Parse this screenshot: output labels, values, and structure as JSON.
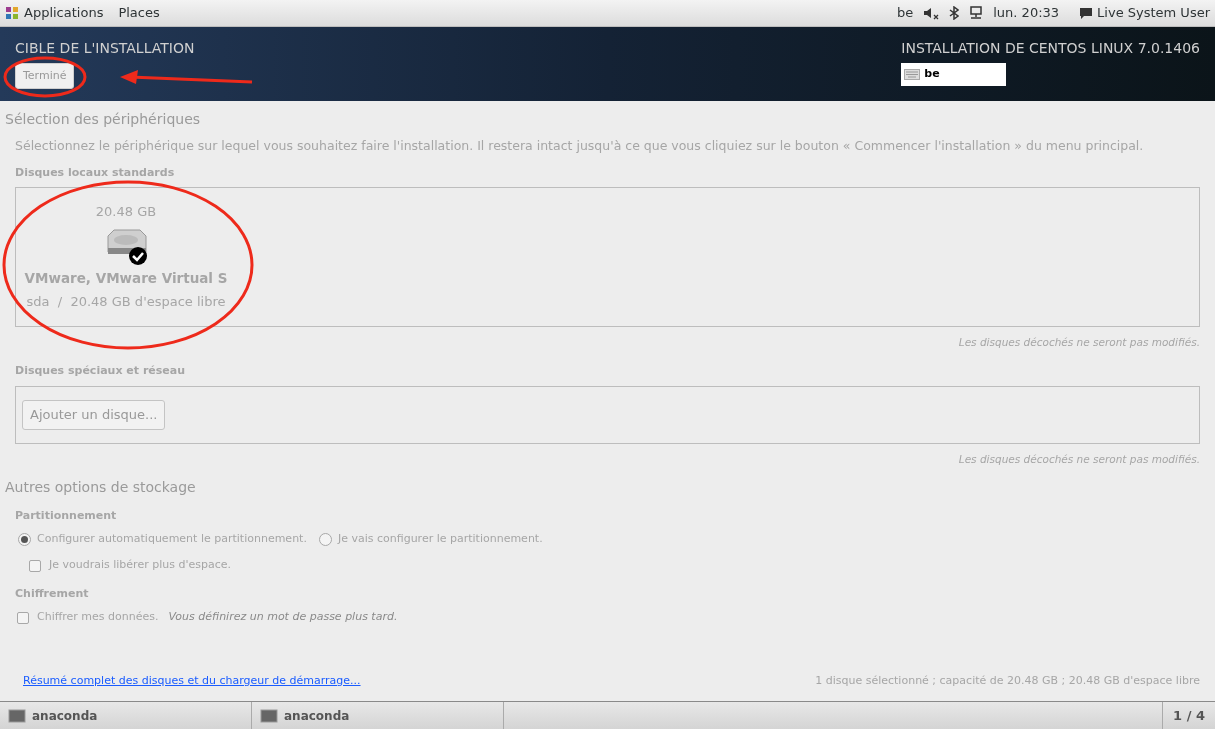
{
  "top_bar": {
    "menus": [
      "Applications",
      "Places"
    ],
    "keyboard": "be",
    "clock": "lun. 20:33",
    "user": "Live System User"
  },
  "header": {
    "title": "CIBLE DE L'INSTALLATION",
    "done_button": "Terminé",
    "product": "INSTALLATION DE CENTOS LINUX 7.0.1406",
    "layout": "be"
  },
  "device_selection": {
    "heading": "Sélection des périphériques",
    "description": "Sélectionnez le périphérique sur lequel vous souhaitez faire l'installation. Il restera intact jusqu'à ce que vous cliquiez sur le bouton « Commencer l'installation » du menu principal.",
    "local_disks": {
      "label": "Disques locaux standards",
      "disks": [
        {
          "size": "20.48 GB",
          "name": "VMware, VMware Virtual S",
          "detail": "sda  /  20.48 GB d'espace libre",
          "selected": true
        }
      ],
      "note": "Les disques décochés ne seront pas modifiés."
    },
    "special_disks": {
      "label": "Disques spéciaux et réseau",
      "add_button": "Ajouter un disque...",
      "note": "Les disques décochés ne seront pas modifiés."
    }
  },
  "storage_options": {
    "heading": "Autres options de stockage",
    "partitioning": {
      "label": "Partitionnement",
      "options": [
        {
          "label": "Configurer automatiquement le partitionnement.",
          "selected": true
        },
        {
          "label": "Je vais configurer le partitionnement.",
          "selected": false
        }
      ],
      "reclaim": {
        "label": "Je voudrais libérer plus d'espace.",
        "checked": false
      }
    },
    "encryption": {
      "label": "Chiffrement",
      "checkbox": {
        "label": "Chiffrer mes données.",
        "checked": false
      },
      "hint": "Vous définirez un mot de passe plus tard."
    }
  },
  "footer": {
    "link": "Résumé complet des disques et du chargeur de démarrage...",
    "summary": "1 disque sélectionné ; capacité de 20.48 GB ; 20.48 GB d'espace libre"
  },
  "taskbar": {
    "windows": [
      "anaconda",
      "anaconda"
    ],
    "workspace": "1 / 4"
  }
}
